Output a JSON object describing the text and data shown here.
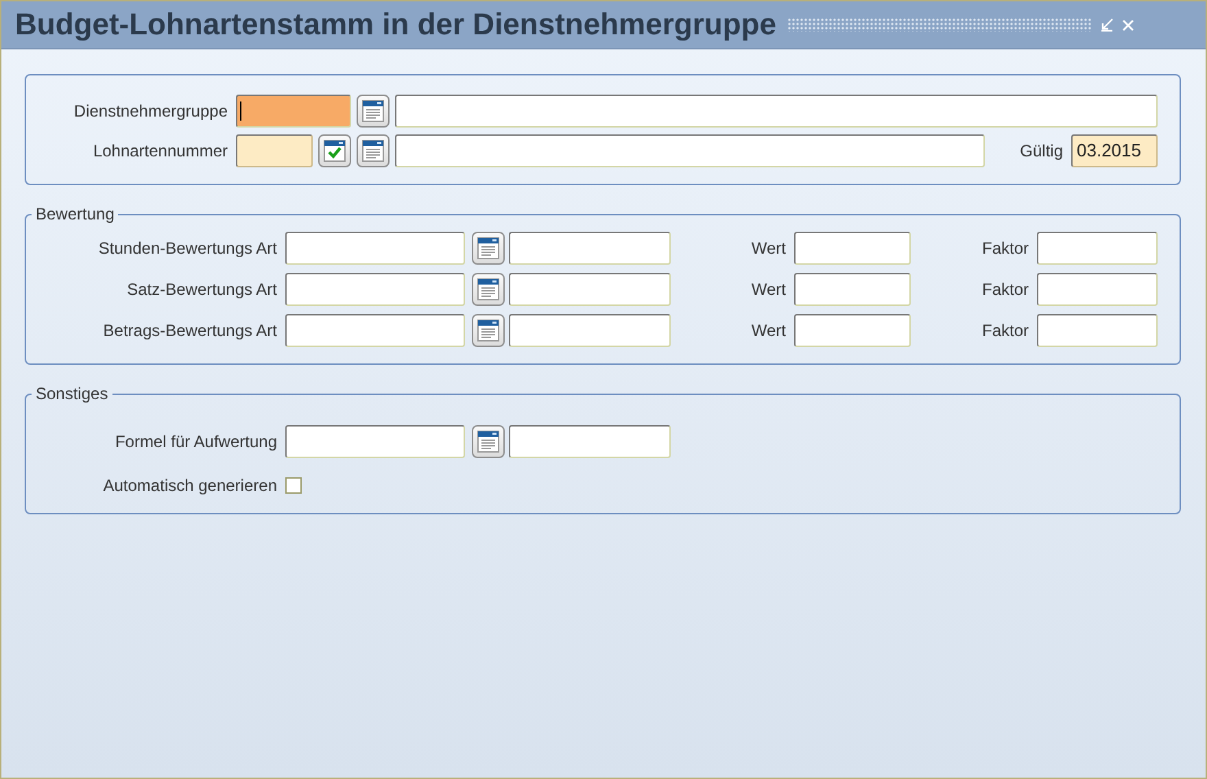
{
  "window": {
    "title": "Budget-Lohnartenstamm in der Dienstnehmergruppe"
  },
  "header": {
    "employee_group": {
      "label": "Dienstnehmergruppe",
      "focused": true,
      "required": false
    },
    "wage_type_number": {
      "label": "Lohnartennummer",
      "focused": false,
      "required": true
    },
    "valid": {
      "label": "Gültig",
      "value": "03.2015",
      "focused": false,
      "required": true
    }
  },
  "valuation": {
    "legend": "Bewertung",
    "rows": [
      {
        "label": "Stunden-Bewertungs Art",
        "value_label": "Wert",
        "factor_label": "Faktor"
      },
      {
        "label": "Satz-Bewertungs Art",
        "value_label": "Wert",
        "factor_label": "Faktor"
      },
      {
        "label": "Betrags-Bewertungs Art",
        "value_label": "Wert",
        "factor_label": "Faktor"
      }
    ]
  },
  "other": {
    "legend": "Sonstiges",
    "formula": {
      "label": "Formel für Aufwertung"
    },
    "auto_generate": {
      "label": "Automatisch generieren",
      "checked": false
    }
  }
}
